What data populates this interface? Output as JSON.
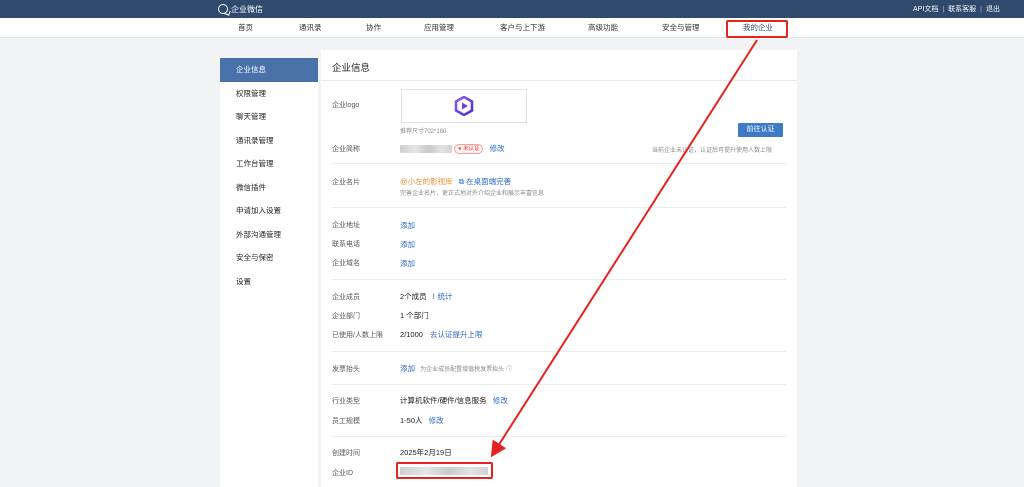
{
  "topbar": {
    "brand": "企业微信",
    "links": [
      "API文档",
      "联系客服",
      "退出"
    ],
    "separator": "|"
  },
  "nav": {
    "items": [
      "首页",
      "通讯录",
      "协作",
      "应用管理",
      "客户与上下游",
      "高级功能",
      "安全与管理",
      "我的企业"
    ],
    "active_index": 7
  },
  "sidebar": {
    "items": [
      "企业信息",
      "权限管理",
      "聊天管理",
      "通讯录管理",
      "工作台管理",
      "微信插件",
      "申请加入设置",
      "外部沟通管理",
      "安全与保密",
      "设置"
    ],
    "active_index": 0
  },
  "main": {
    "title": "企业信息",
    "logo": {
      "label": "企业logo",
      "hint": "推荐尺寸702*180"
    },
    "abbr": {
      "label": "企业简称",
      "badge": "未认证",
      "edit": "修改"
    },
    "cert": {
      "button": "前往认证",
      "note": "当前企业未认证，认证后可提升使用人数上限"
    },
    "card": {
      "label": "企业名片",
      "name": "@小左的影视库",
      "action": "在桌面端完善",
      "desc": "完善企业名片，更正式地对外介绍企业和展示丰富信息"
    },
    "address": {
      "label": "企业地址",
      "value": "添加"
    },
    "phone": {
      "label": "联系电话",
      "value": "添加"
    },
    "domain": {
      "label": "企业域名",
      "value": "添加"
    },
    "members": {
      "label": "企业成员",
      "value": "2个成员",
      "link": "统计"
    },
    "depts": {
      "label": "企业部门",
      "value": "1 个部门"
    },
    "usage": {
      "label": "已使用/人数上限",
      "value": "2/1000",
      "link": "去认证提升上限"
    },
    "invoice": {
      "label": "发票抬头",
      "value": "添加",
      "hint": "为企业成员配置增值税发票抬头"
    },
    "industry": {
      "label": "行业类型",
      "value": "计算机软件/硬件/信息服务",
      "edit": "修改"
    },
    "size": {
      "label": "员工规模",
      "value": "1-50人",
      "edit": "修改"
    },
    "created": {
      "label": "创建时间",
      "value": "2025年2月19日"
    },
    "corpid": {
      "label": "企业ID"
    }
  },
  "colors": {
    "topbar": "#2f4a6d",
    "accent": "#4a72aa",
    "link": "#2a6bc4",
    "annotation": "#e5221d"
  }
}
